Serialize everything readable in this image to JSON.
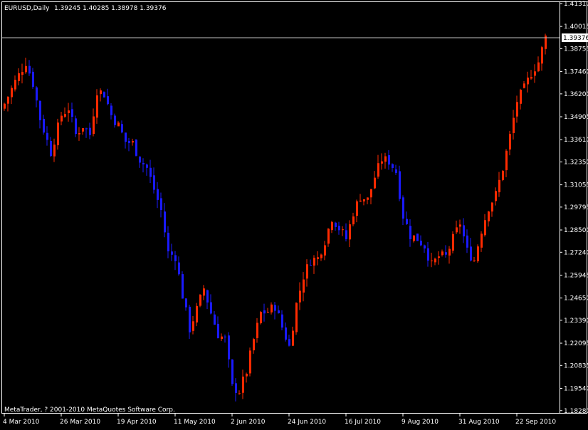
{
  "header": {
    "symbol": "EURUSD,Daily",
    "ohlc": "1.39245 1.40285 1.38978 1.39376"
  },
  "footer": {
    "copyright": "MetaTrader, ? 2001-2010 MetaQuotes Software Corp."
  },
  "current_price_label": "1.39376",
  "colors": {
    "background": "#000000",
    "frame": "#ffffff",
    "bull": "#ff2a00",
    "bear": "#1a1aff",
    "text": "#ffffff",
    "price_line": "#c0c0c0",
    "price_tag_bg": "#ffffff",
    "price_tag_text": "#000000"
  },
  "chart_data": {
    "type": "candlestick",
    "ylim": [
      1.1823,
      1.4131
    ],
    "y_ticks": [
      "1.41310",
      "1.40015",
      "1.38755",
      "1.37460",
      "1.36200",
      "1.34905",
      "1.33610",
      "1.32350",
      "1.31055",
      "1.29795",
      "1.28500",
      "1.27240",
      "1.25945",
      "1.24650",
      "1.23390",
      "1.22095",
      "1.20835",
      "1.19540",
      "1.18280"
    ],
    "x_ticks": [
      {
        "label": "4 Mar 2010",
        "index": 0
      },
      {
        "label": "26 Mar 2010",
        "index": 16
      },
      {
        "label": "19 Apr 2010",
        "index": 32
      },
      {
        "label": "11 May 2010",
        "index": 48
      },
      {
        "label": "2 Jun 2010",
        "index": 64
      },
      {
        "label": "24 Jun 2010",
        "index": 80
      },
      {
        "label": "16 Jul 2010",
        "index": 96
      },
      {
        "label": "9 Aug 2010",
        "index": 112
      },
      {
        "label": "31 Aug 2010",
        "index": 128
      },
      {
        "label": "22 Sep 2010",
        "index": 144
      }
    ],
    "current_price": 1.39376,
    "close_path": [
      [
        0,
        1.3565
      ],
      [
        3,
        1.369
      ],
      [
        6,
        1.38
      ],
      [
        8,
        1.368
      ],
      [
        10,
        1.348
      ],
      [
        13,
        1.329
      ],
      [
        16,
        1.35
      ],
      [
        18,
        1.354
      ],
      [
        20,
        1.339
      ],
      [
        22,
        1.344
      ],
      [
        24,
        1.339
      ],
      [
        26,
        1.364
      ],
      [
        28,
        1.362
      ],
      [
        30,
        1.35
      ],
      [
        32,
        1.344
      ],
      [
        34,
        1.335
      ],
      [
        36,
        1.334
      ],
      [
        38,
        1.325
      ],
      [
        40,
        1.32
      ],
      [
        42,
        1.308
      ],
      [
        44,
        1.296
      ],
      [
        46,
        1.272
      ],
      [
        48,
        1.27
      ],
      [
        50,
        1.248
      ],
      [
        52,
        1.229
      ],
      [
        54,
        1.24
      ],
      [
        56,
        1.252
      ],
      [
        58,
        1.238
      ],
      [
        60,
        1.226
      ],
      [
        62,
        1.223
      ],
      [
        64,
        1.196
      ],
      [
        66,
        1.194
      ],
      [
        68,
        1.205
      ],
      [
        70,
        1.223
      ],
      [
        72,
        1.238
      ],
      [
        74,
        1.239
      ],
      [
        76,
        1.242
      ],
      [
        78,
        1.23
      ],
      [
        80,
        1.219
      ],
      [
        82,
        1.243
      ],
      [
        84,
        1.259
      ],
      [
        86,
        1.268
      ],
      [
        88,
        1.269
      ],
      [
        90,
        1.279
      ],
      [
        92,
        1.292
      ],
      [
        94,
        1.286
      ],
      [
        96,
        1.28
      ],
      [
        98,
        1.295
      ],
      [
        100,
        1.304
      ],
      [
        102,
        1.302
      ],
      [
        104,
        1.315
      ],
      [
        106,
        1.325
      ],
      [
        108,
        1.324
      ],
      [
        110,
        1.318
      ],
      [
        112,
        1.293
      ],
      [
        114,
        1.282
      ],
      [
        116,
        1.28
      ],
      [
        118,
        1.276
      ],
      [
        120,
        1.265
      ],
      [
        122,
        1.27
      ],
      [
        124,
        1.27
      ],
      [
        126,
        1.28
      ],
      [
        128,
        1.289
      ],
      [
        130,
        1.273
      ],
      [
        132,
        1.268
      ],
      [
        134,
        1.285
      ],
      [
        136,
        1.298
      ],
      [
        138,
        1.305
      ],
      [
        140,
        1.32
      ],
      [
        142,
        1.338
      ],
      [
        144,
        1.358
      ],
      [
        146,
        1.365
      ],
      [
        148,
        1.374
      ],
      [
        150,
        1.38
      ],
      [
        152,
        1.394
      ]
    ]
  }
}
